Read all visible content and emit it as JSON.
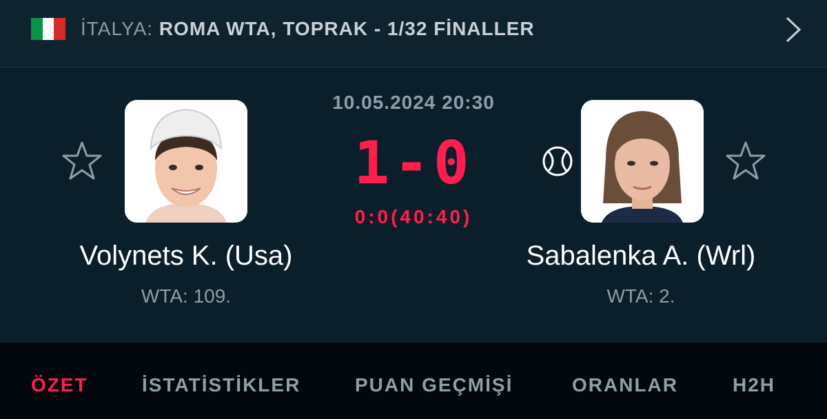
{
  "header": {
    "flag_colors": [
      "#0a9447",
      "#ffffff",
      "#d62b2b"
    ],
    "country": "İTALYA:",
    "league": "ROMA WTA, TOPRAK - 1/32 FİNALLER",
    "next_icon": "chevron-right-icon"
  },
  "match": {
    "datetime": "10.05.2024 20:30",
    "score": "1-0",
    "game_score": "0:0(40:40)",
    "accent_color": "#ff1e4d"
  },
  "home": {
    "name": "Volynets K. (Usa)",
    "rank": "WTA: 109.",
    "favorite_icon": "star-outline-icon"
  },
  "away": {
    "name": "Sabalenka A. (Wrl)",
    "rank": "WTA: 2.",
    "favorite_icon": "star-outline-icon",
    "serving_icon": "tennis-ball-icon"
  },
  "tabs": [
    {
      "label": "ÖZET",
      "active": true
    },
    {
      "label": "İSTATİSTİKLER",
      "active": false
    },
    {
      "label": "PUAN GEÇMİŞİ",
      "active": false
    },
    {
      "label": "ORANLAR",
      "active": false
    },
    {
      "label": "H2H",
      "active": false
    }
  ]
}
